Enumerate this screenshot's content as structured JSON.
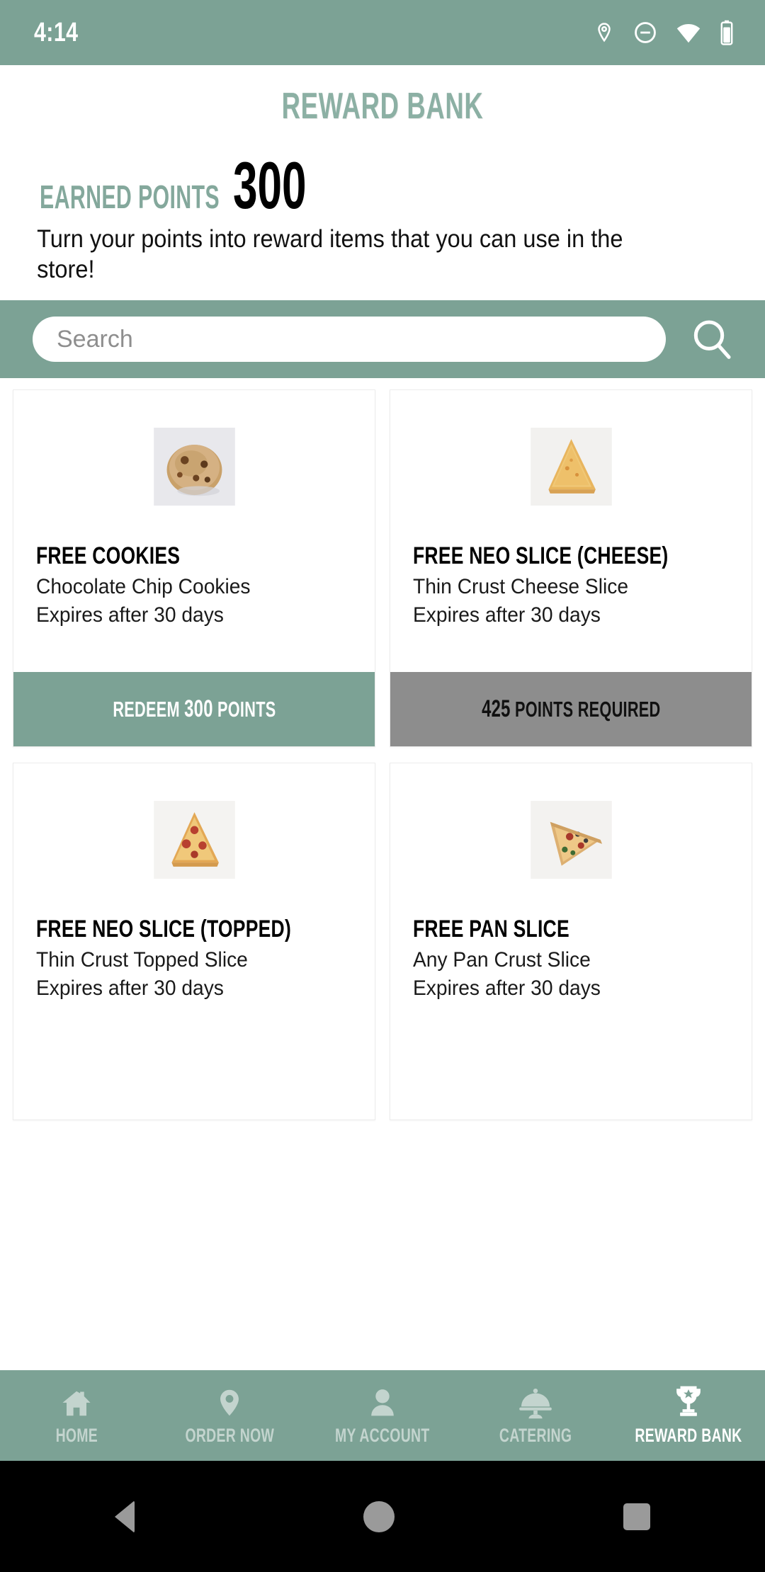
{
  "theme": {
    "accent": "#7ca295",
    "accent_light": "#8cb0a4",
    "locked_gray": "#8d8d8d",
    "text_dark": "#000000",
    "nav_inactive": "#c3d4ce"
  },
  "status_bar": {
    "time": "4:14",
    "icons": [
      "location-pin-icon",
      "do-not-disturb-icon",
      "wifi-icon",
      "battery-icon"
    ]
  },
  "header": {
    "app_title": "REWARD BANK",
    "points_label": "EARNED POINTS",
    "points_value": "300",
    "tagline": "Turn your points into reward items that you can use in the store!"
  },
  "search": {
    "value": "",
    "placeholder": "Search",
    "icon": "search-icon"
  },
  "rewards": [
    {
      "title": "FREE COOKIES",
      "description": "Chocolate Chip Cookies",
      "expiry": "Expires after 30 days",
      "image": "chocolate-chip-cookie",
      "cta_prefix": "REDEEM ",
      "cta_points": "300",
      "cta_suffix": " POINTS",
      "state": "available"
    },
    {
      "title": "FREE NEO SLICE (CHEESE)",
      "description": "Thin Crust Cheese Slice",
      "expiry": "Expires after 30 days",
      "image": "cheese-pizza-slice",
      "cta_prefix": "",
      "cta_points": "425",
      "cta_suffix": " POINTS REQUIRED",
      "state": "locked"
    },
    {
      "title": "FREE NEO SLICE (TOPPED)",
      "description": "Thin Crust Topped Slice",
      "expiry": "Expires after 30 days",
      "image": "pepperoni-pizza-slice",
      "cta_prefix": "",
      "cta_points": "",
      "cta_suffix": "",
      "state": "hidden"
    },
    {
      "title": "FREE PAN SLICE",
      "description": "Any Pan Crust Slice",
      "expiry": "Expires after 30 days",
      "image": "supreme-pizza-slice",
      "cta_prefix": "",
      "cta_points": "",
      "cta_suffix": "",
      "state": "hidden"
    }
  ],
  "bottom_nav": [
    {
      "label": "HOME",
      "icon": "home-icon",
      "active": false
    },
    {
      "label": "ORDER NOW",
      "icon": "location-pin-icon",
      "active": false
    },
    {
      "label": "MY ACCOUNT",
      "icon": "person-icon",
      "active": false
    },
    {
      "label": "CATERING",
      "icon": "cloche-icon",
      "active": false
    },
    {
      "label": "REWARD BANK",
      "icon": "trophy-icon",
      "active": true
    }
  ],
  "system_nav": {
    "back": "back-icon",
    "home": "home-circle-icon",
    "recents": "recents-icon"
  }
}
